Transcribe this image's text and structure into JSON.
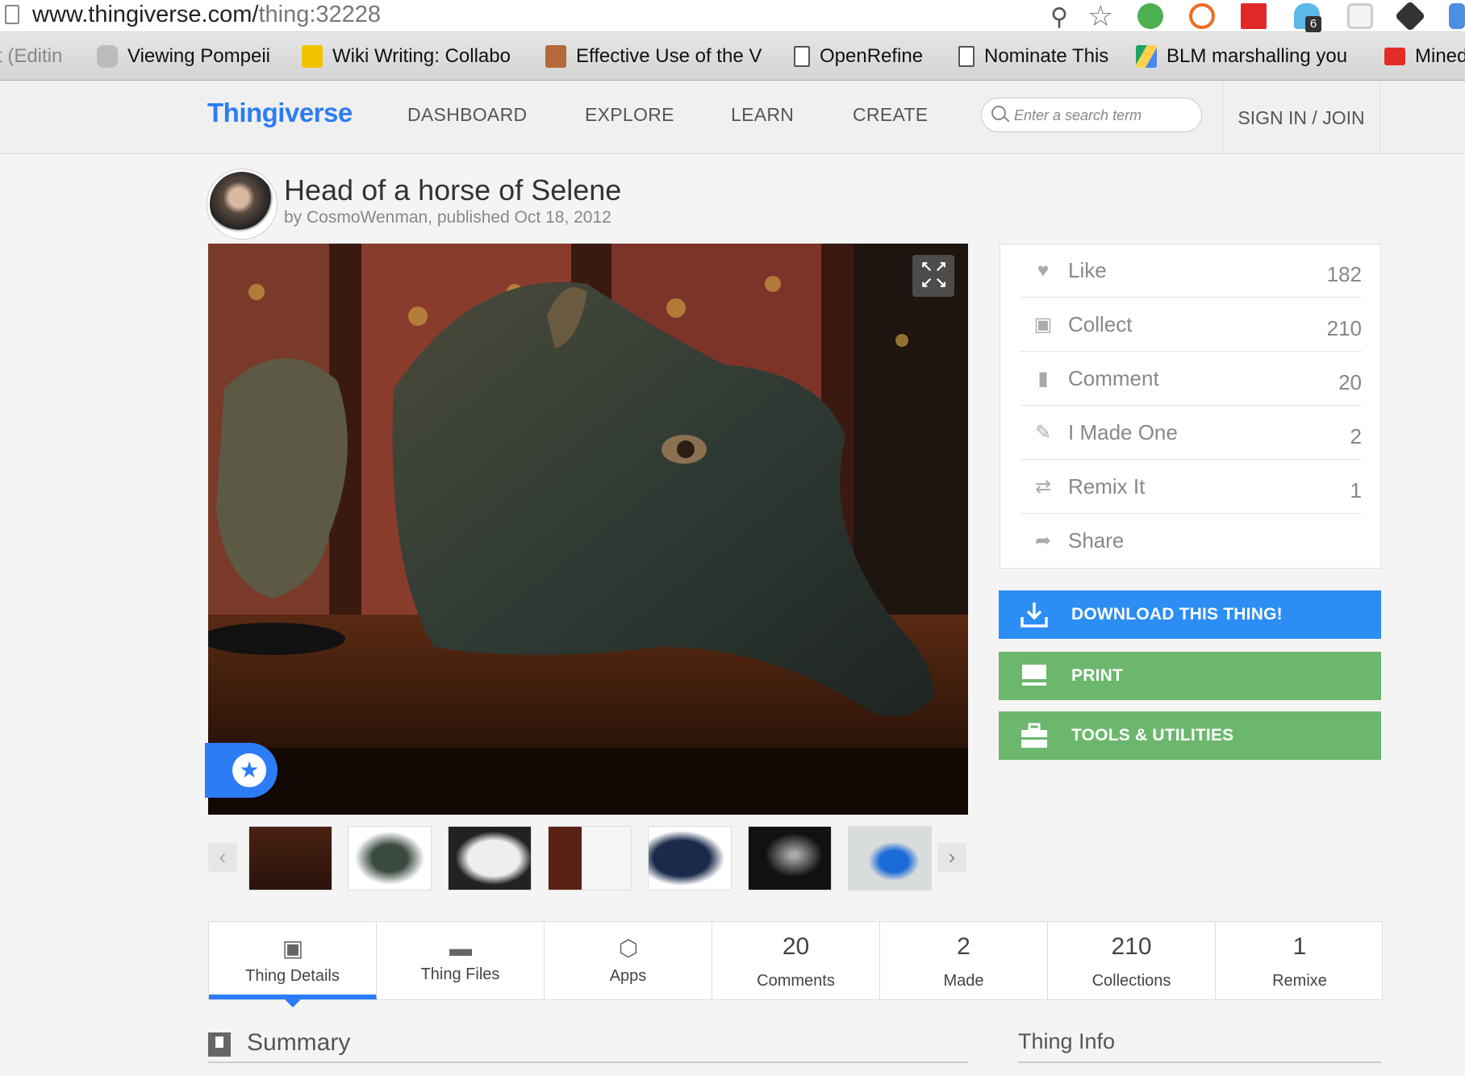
{
  "browser": {
    "url_host": "www.thingiverse.com/",
    "url_path": "thing:32228",
    "ext_badge": "6",
    "bookmarks": [
      {
        "label": "t (Editin",
        "icon": "doc-icon"
      },
      {
        "label": "Viewing Pompeii",
        "icon": "apple-icon"
      },
      {
        "label": "Wiki Writing: Collabo",
        "icon": "michigan-icon"
      },
      {
        "label": "Effective Use of the V",
        "icon": "stack-icon"
      },
      {
        "label": "OpenRefine",
        "icon": "doc-icon"
      },
      {
        "label": "Nominate This",
        "icon": "doc-icon"
      },
      {
        "label": "BLM marshalling you",
        "icon": "drive-icon"
      },
      {
        "label": "Mined",
        "icon": "youtube-icon"
      }
    ]
  },
  "header": {
    "logo": "Thingiverse",
    "nav": [
      "DASHBOARD",
      "EXPLORE",
      "LEARN",
      "CREATE"
    ],
    "search_placeholder": "Enter a search term",
    "signin": "SIGN IN / JOIN"
  },
  "thing": {
    "title": "Head of a horse of Selene",
    "byline": "by CosmoWenman, published Oct 18, 2012"
  },
  "actions": [
    {
      "label": "Like",
      "count": "182",
      "icon": "heart-icon"
    },
    {
      "label": "Collect",
      "count": "210",
      "icon": "collect-icon"
    },
    {
      "label": "Comment",
      "count": "20",
      "icon": "comment-icon"
    },
    {
      "label": "I Made One",
      "count": "2",
      "icon": "made-icon"
    },
    {
      "label": "Remix It",
      "count": "1",
      "icon": "remix-icon"
    },
    {
      "label": "Share",
      "count": "",
      "icon": "share-icon"
    }
  ],
  "buttons": {
    "download": "DOWNLOAD THIS THING!",
    "print": "PRINT",
    "tools": "TOOLS & UTILITIES"
  },
  "tabs": [
    {
      "label": "Thing Details",
      "icon": "book-icon"
    },
    {
      "label": "Thing Files",
      "icon": "folder-icon"
    },
    {
      "label": "Apps",
      "icon": "cube-icon"
    },
    {
      "num": "20",
      "label": "Comments"
    },
    {
      "num": "2",
      "label": "Made"
    },
    {
      "num": "210",
      "label": "Collections"
    },
    {
      "num": "1",
      "label": "Remixe"
    }
  ],
  "sections": {
    "summary": "Summary",
    "thing_info": "Thing Info"
  },
  "colors": {
    "brand": "#2c7df5",
    "green": "#6bb76d"
  }
}
